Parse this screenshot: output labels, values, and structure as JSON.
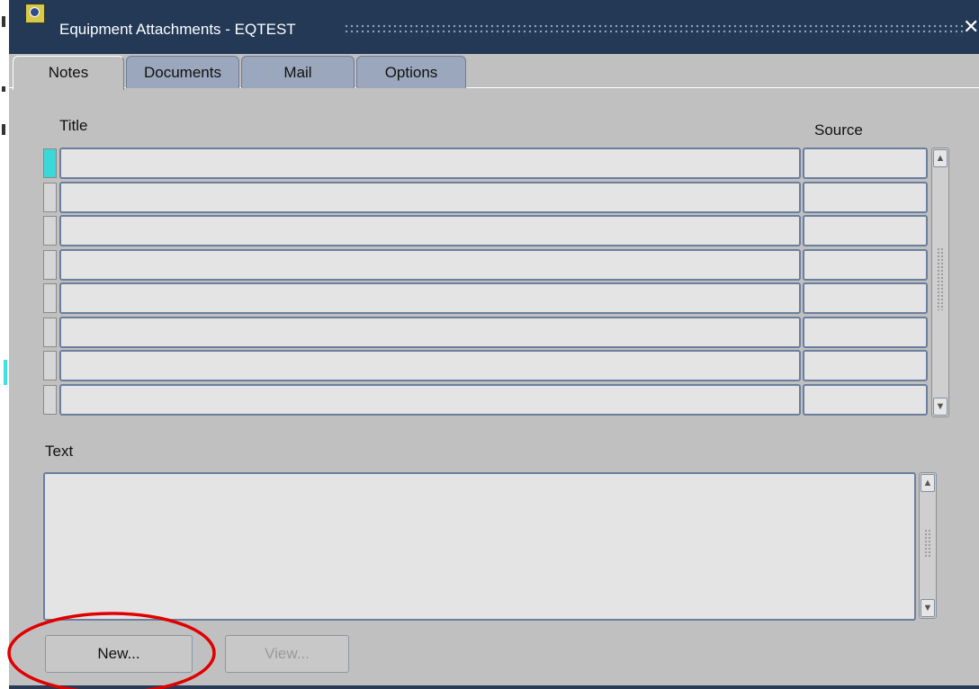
{
  "window": {
    "title": "Equipment Attachments - EQTEST",
    "close_glyph": "✕"
  },
  "tabs": [
    {
      "label": "Notes",
      "active": true
    },
    {
      "label": "Documents",
      "active": false
    },
    {
      "label": "Mail",
      "active": false
    },
    {
      "label": "Options",
      "active": false
    }
  ],
  "notes": {
    "title_header": "Title",
    "source_header": "Source",
    "rows": [
      {
        "title": "",
        "source": ""
      },
      {
        "title": "",
        "source": ""
      },
      {
        "title": "",
        "source": ""
      },
      {
        "title": "",
        "source": ""
      },
      {
        "title": "",
        "source": ""
      },
      {
        "title": "",
        "source": ""
      },
      {
        "title": "",
        "source": ""
      },
      {
        "title": "",
        "source": ""
      }
    ],
    "text_label": "Text",
    "text_value": ""
  },
  "buttons": {
    "new_label": "New...",
    "view_label": "View..."
  },
  "icons": {
    "scroll_up": "▲",
    "scroll_down": "▼"
  },
  "colors": {
    "titlebar": "#233956",
    "window_bg": "#c0c0c0",
    "field_border": "#6b7f9d",
    "current_record": "#3ad8d8",
    "annotation": "#e00000"
  }
}
